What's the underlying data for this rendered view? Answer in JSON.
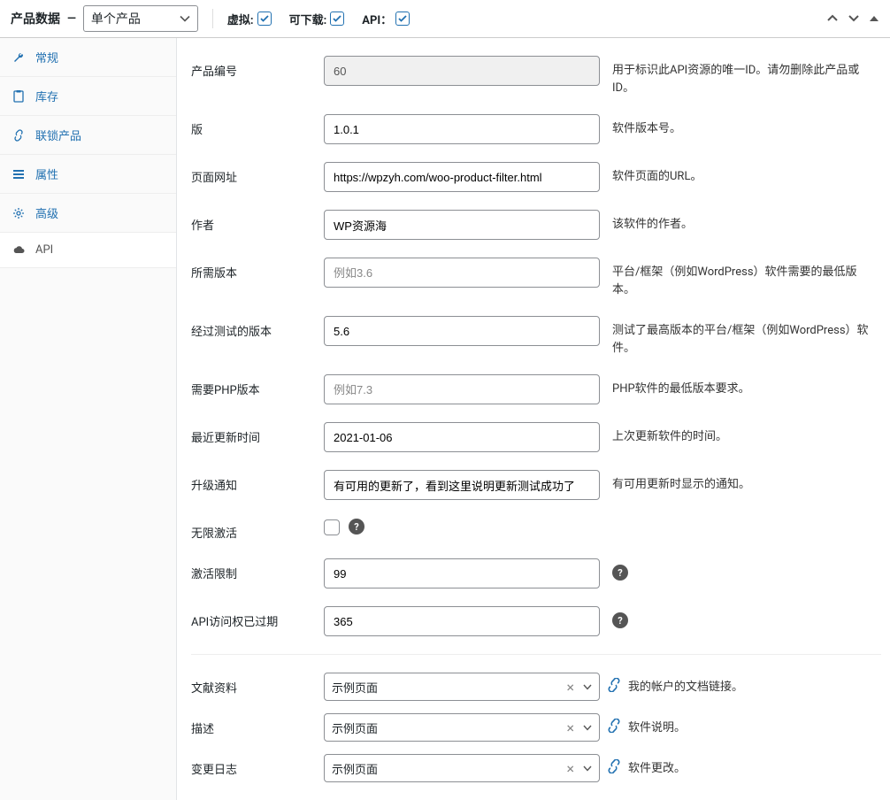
{
  "header": {
    "title": "产品数据",
    "dash": "—",
    "product_type": "单个产品",
    "virtual_label": "虚拟:",
    "downloadable_label": "可下载:",
    "api_label": "API："
  },
  "sidebar": {
    "items": [
      {
        "label": "常规",
        "icon": "wrench"
      },
      {
        "label": "库存",
        "icon": "clipboard"
      },
      {
        "label": "联锁产品",
        "icon": "link"
      },
      {
        "label": "属性",
        "icon": "list"
      },
      {
        "label": "高级",
        "icon": "gear"
      },
      {
        "label": "API",
        "icon": "cloud"
      }
    ]
  },
  "fields": {
    "product_id": {
      "label": "产品编号",
      "value": "60",
      "help": "用于标识此API资源的唯一ID。请勿删除此产品或ID。"
    },
    "version": {
      "label": "版",
      "value": "1.0.1",
      "help": "软件版本号。"
    },
    "page_url": {
      "label": "页面网址",
      "value": "https://wpzyh.com/woo-product-filter.html",
      "help": "软件页面的URL。"
    },
    "author": {
      "label": "作者",
      "value": "WP资源海",
      "help": "该软件的作者。"
    },
    "required_version": {
      "label": "所需版本",
      "placeholder": "例如3.6",
      "help": "平台/框架（例如WordPress）软件需要的最低版本。"
    },
    "tested_version": {
      "label": "经过测试的版本",
      "value": "5.6",
      "help": "测试了最高版本的平台/框架（例如WordPress）软件。"
    },
    "php_version": {
      "label": "需要PHP版本",
      "placeholder": "例如7.3",
      "help": "PHP软件的最低版本要求。"
    },
    "last_updated": {
      "label": "最近更新时间",
      "value": "2021-01-06",
      "help": "上次更新软件的时间。"
    },
    "upgrade_notice": {
      "label": "升级通知",
      "value": "有可用的更新了，看到这里说明更新测试成功了",
      "help": "有可用更新时显示的通知。"
    },
    "unlimited_activation": {
      "label": "无限激活"
    },
    "activation_limit": {
      "label": "激活限制",
      "value": "99"
    },
    "api_expire": {
      "label": "API访问权已过期",
      "value": "365"
    },
    "documentation": {
      "label": "文献资料",
      "value": "示例页面",
      "help": "我的帐户的文档链接。"
    },
    "description": {
      "label": "描述",
      "value": "示例页面",
      "help": "软件说明。"
    },
    "changelog": {
      "label": "变更日志",
      "value": "示例页面",
      "help": "软件更改。"
    }
  }
}
